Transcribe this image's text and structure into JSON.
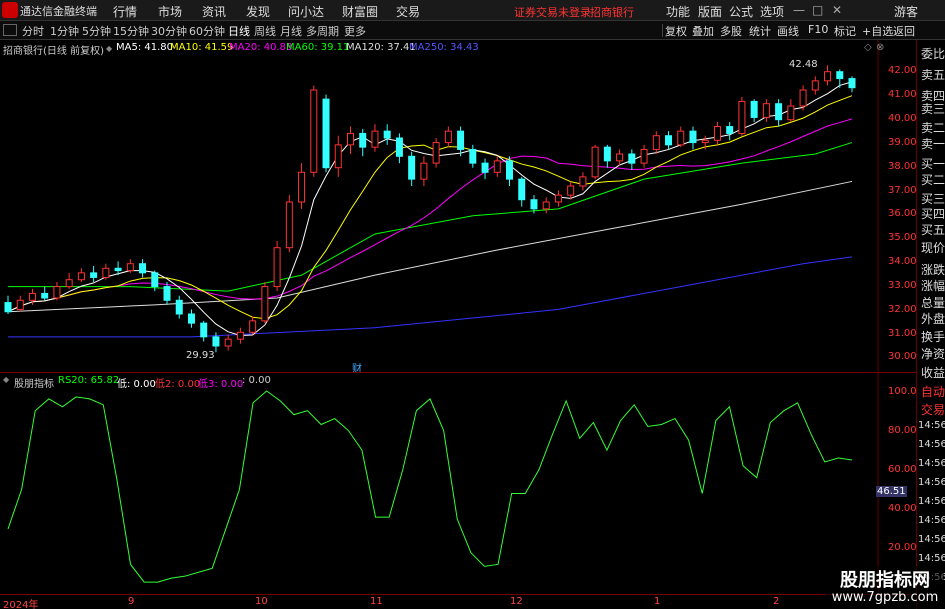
{
  "menubar": {
    "app_title": "通达信金融终端",
    "items": [
      "行情",
      "市场",
      "资讯",
      "发现",
      "问小达",
      "财富圈",
      "交易"
    ],
    "notice": "证券交易未登录",
    "stock_name": "招商银行",
    "right_items": [
      "功能",
      "版面",
      "公式",
      "选项"
    ],
    "guest": "游客",
    "win_controls": [
      "—",
      "□",
      "✕"
    ]
  },
  "periodbar": {
    "tabs": [
      "分时",
      "1分钟",
      "5分钟",
      "15分钟",
      "30分钟",
      "60分钟",
      "日线",
      "周线",
      "月线",
      "多周期",
      "更多"
    ],
    "active_tab": "日线",
    "tools": [
      "复权",
      "叠加",
      "多股",
      "统计",
      "画线",
      "F10",
      "标记",
      "+自选",
      "返回"
    ]
  },
  "main_legend": {
    "title": "招商银行(日线 前复权)",
    "ma5": "MA5: 41.80",
    "ma10": "MA10: 41.59",
    "ma20": "MA20: 40.88",
    "ma60": "MA60: 39.11",
    "ma120": "MA120: 37.41",
    "ma250": "MA250: 34.43",
    "colors": {
      "ma5": "#ffffff",
      "ma10": "#ffff00",
      "ma20": "#ff00ff",
      "ma60": "#00ff00",
      "ma120": "#ffffff",
      "ma250": "#3333ff"
    }
  },
  "price_axis": [
    "42.00",
    "41.00",
    "40.00",
    "39.00",
    "38.00",
    "37.00",
    "36.00",
    "35.00",
    "34.00",
    "33.00",
    "32.00",
    "31.00",
    "30.00"
  ],
  "annotations": {
    "high": "42.48",
    "low": "29.93",
    "fin_mark": "财"
  },
  "indicator": {
    "name": "股朋指标",
    "rs20": "RS20: 65.82",
    "di": "低: 0.00",
    "di2": "低2: 0.00",
    "di3": "低3: 0.00",
    "extra": ": 0.00",
    "axis": [
      "100.0",
      "80.00",
      "60.00",
      "40.00",
      "20.00"
    ],
    "current_value": "46.51",
    "rs_values": [
      30,
      50,
      90,
      96,
      92,
      97,
      96,
      93,
      55,
      12,
      3,
      3,
      5,
      6,
      8,
      10,
      30,
      50,
      94,
      100,
      95,
      88,
      90,
      83,
      86,
      80,
      70,
      36,
      36,
      60,
      90,
      96,
      80,
      35,
      18,
      11,
      12,
      48,
      48,
      60,
      78,
      95,
      76,
      84,
      70,
      85,
      93,
      82,
      83,
      86,
      75,
      48,
      85,
      92,
      62,
      56,
      84,
      90,
      94,
      78,
      64,
      66,
      65
    ]
  },
  "side_panel": [
    "委比",
    "卖五",
    "卖四",
    "卖三",
    "卖二",
    "卖一",
    "买一",
    "买二",
    "买三",
    "买四",
    "买五",
    "现价",
    "涨跌",
    "涨幅",
    "总量",
    "外盘",
    "换手",
    "净资",
    "收益",
    "自动",
    "交易",
    "14:56",
    "14:56",
    "14:56",
    "14:56",
    "14:56",
    "14:56",
    "14:56",
    "14:56",
    "14:56"
  ],
  "x_axis": [
    "2024年",
    "9",
    "10",
    "11",
    "12",
    "1",
    "2"
  ],
  "watermark": {
    "line1": "股朋指标网",
    "line2": "www.7gpzb.com"
  },
  "chart_data": {
    "type": "candlestick",
    "price_range": [
      29.5,
      42.8
    ],
    "candles": [
      [
        32.1,
        31.7,
        32.4,
        31.6
      ],
      [
        31.8,
        32.2,
        32.4,
        31.7
      ],
      [
        32.2,
        32.5,
        32.7,
        32.0
      ],
      [
        32.5,
        32.3,
        32.8,
        32.2
      ],
      [
        32.3,
        32.8,
        33.0,
        32.2
      ],
      [
        32.8,
        33.1,
        33.4,
        32.7
      ],
      [
        33.1,
        33.4,
        33.6,
        33.0
      ],
      [
        33.4,
        33.2,
        33.7,
        33.0
      ],
      [
        33.2,
        33.6,
        33.8,
        33.1
      ],
      [
        33.6,
        33.5,
        33.9,
        33.3
      ],
      [
        33.5,
        33.8,
        34.0,
        33.4
      ],
      [
        33.8,
        33.4,
        34.0,
        33.2
      ],
      [
        33.4,
        32.8,
        33.5,
        32.6
      ],
      [
        32.8,
        32.2,
        33.0,
        32.0
      ],
      [
        32.2,
        31.6,
        32.4,
        31.4
      ],
      [
        31.6,
        31.2,
        31.8,
        31.0
      ],
      [
        31.2,
        30.6,
        31.3,
        30.4
      ],
      [
        30.6,
        30.2,
        30.8,
        29.93
      ],
      [
        30.2,
        30.5,
        30.7,
        30.0
      ],
      [
        30.5,
        30.8,
        31.0,
        30.3
      ],
      [
        30.8,
        31.3,
        31.5,
        30.7
      ],
      [
        31.3,
        32.8,
        33.0,
        31.2
      ],
      [
        32.8,
        34.5,
        34.8,
        32.6
      ],
      [
        34.5,
        36.5,
        36.8,
        34.3
      ],
      [
        36.5,
        37.8,
        38.2,
        36.2
      ],
      [
        37.8,
        41.4,
        41.6,
        37.6
      ],
      [
        41.0,
        38.0,
        41.2,
        37.8
      ],
      [
        38.0,
        39.0,
        39.4,
        37.6
      ],
      [
        39.0,
        39.5,
        39.8,
        38.6
      ],
      [
        39.5,
        38.9,
        39.7,
        38.5
      ],
      [
        38.9,
        39.6,
        39.9,
        38.7
      ],
      [
        39.6,
        39.3,
        39.9,
        39.0
      ],
      [
        39.3,
        38.5,
        39.5,
        38.2
      ],
      [
        38.5,
        37.5,
        38.7,
        37.2
      ],
      [
        37.5,
        38.2,
        38.5,
        37.2
      ],
      [
        38.2,
        39.1,
        39.3,
        38.0
      ],
      [
        39.1,
        39.6,
        39.8,
        38.9
      ],
      [
        39.6,
        38.8,
        39.8,
        38.5
      ],
      [
        38.8,
        38.2,
        39.0,
        38.0
      ],
      [
        38.2,
        37.8,
        38.4,
        37.5
      ],
      [
        37.8,
        38.3,
        38.5,
        37.6
      ],
      [
        38.3,
        37.5,
        38.5,
        37.2
      ],
      [
        37.5,
        36.6,
        37.6,
        36.3
      ],
      [
        36.6,
        36.2,
        36.8,
        36.0
      ],
      [
        36.2,
        36.5,
        36.7,
        36.0
      ],
      [
        36.5,
        36.8,
        37.0,
        36.3
      ],
      [
        36.8,
        37.2,
        37.4,
        36.6
      ],
      [
        37.2,
        37.6,
        37.8,
        37.0
      ],
      [
        37.6,
        38.9,
        39.0,
        37.5
      ],
      [
        38.9,
        38.3,
        39.0,
        38.0
      ],
      [
        38.3,
        38.6,
        38.8,
        38.1
      ],
      [
        38.6,
        38.2,
        38.8,
        37.9
      ],
      [
        38.2,
        38.8,
        39.0,
        38.0
      ],
      [
        38.8,
        39.4,
        39.6,
        38.6
      ],
      [
        39.4,
        39.0,
        39.6,
        38.8
      ],
      [
        39.0,
        39.6,
        39.8,
        38.9
      ],
      [
        39.6,
        39.1,
        39.8,
        38.8
      ],
      [
        39.1,
        39.2,
        39.4,
        38.8
      ],
      [
        39.2,
        39.8,
        40.0,
        39.0
      ],
      [
        39.8,
        39.5,
        40.0,
        39.2
      ],
      [
        39.5,
        40.9,
        41.1,
        39.4
      ],
      [
        40.9,
        40.2,
        41.0,
        40.0
      ],
      [
        40.2,
        40.8,
        41.0,
        40.0
      ],
      [
        40.8,
        40.1,
        41.0,
        39.8
      ],
      [
        40.1,
        40.7,
        41.0,
        40.0
      ],
      [
        40.7,
        41.4,
        41.6,
        40.5
      ],
      [
        41.4,
        41.8,
        42.0,
        41.2
      ],
      [
        41.8,
        42.2,
        42.48,
        41.6
      ],
      [
        42.2,
        41.9,
        42.3,
        41.5
      ],
      [
        41.9,
        41.5,
        42.0,
        41.3
      ]
    ]
  }
}
